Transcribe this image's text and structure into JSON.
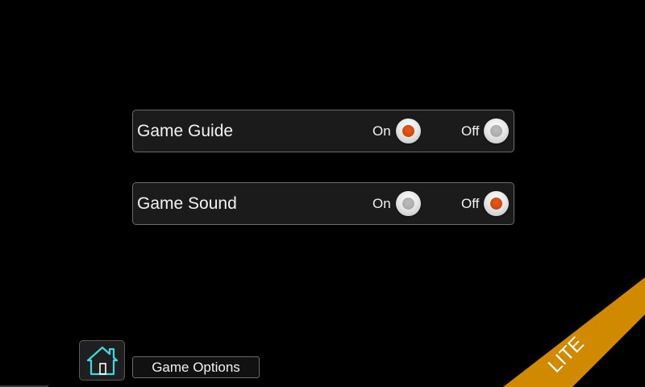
{
  "options": [
    {
      "label": "Game Guide",
      "on_label": "On",
      "off_label": "Off",
      "selected": "on"
    },
    {
      "label": "Game Sound",
      "on_label": "On",
      "off_label": "Off",
      "selected": "off"
    }
  ],
  "footer": {
    "home_icon": "home-icon",
    "screen_title": "Game Options"
  },
  "badge": {
    "text": "LITE"
  },
  "colors": {
    "background": "#000000",
    "row_background": "#1b1b1b",
    "radio_selected": "#d94c10",
    "radio_unselected": "#b0b0b0",
    "home_icon": "#3fd8e0",
    "ribbon": "#d18a00"
  }
}
